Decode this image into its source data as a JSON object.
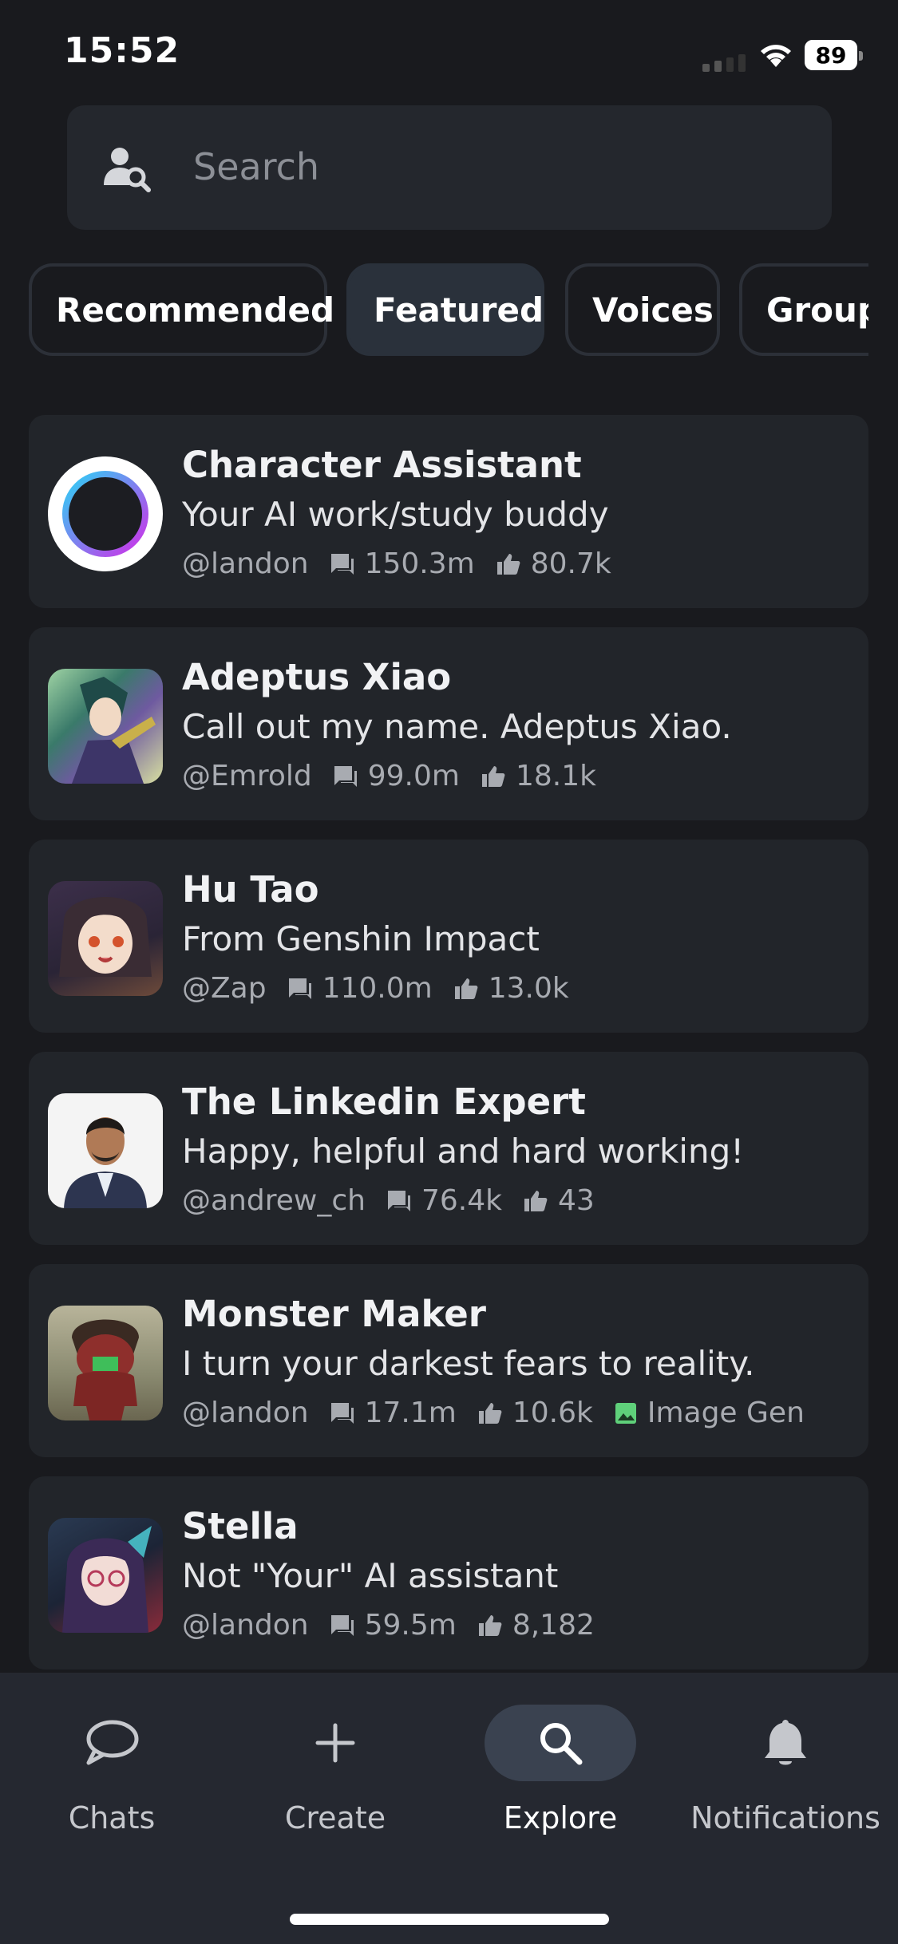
{
  "status_bar": {
    "time": "15:52",
    "battery": "89"
  },
  "search": {
    "placeholder": "Search"
  },
  "tabs": [
    {
      "label": "Recommended",
      "active": false
    },
    {
      "label": "Featured",
      "active": true
    },
    {
      "label": "Voices",
      "active": false
    },
    {
      "label": "Groups",
      "active": false
    }
  ],
  "characters": [
    {
      "name": "Character Assistant",
      "description": "Your AI work/study buddy",
      "author": "@landon",
      "chats": "150.3m",
      "likes": "80.7k",
      "avatar_icon": "ring-logo"
    },
    {
      "name": "Adeptus Xiao",
      "description": "Call out my name. Adeptus Xiao.",
      "author": "@Emrold",
      "chats": "99.0m",
      "likes": "18.1k",
      "avatar_icon": "anime-portrait"
    },
    {
      "name": "Hu Tao",
      "description": "From Genshin Impact",
      "author": "@Zap",
      "chats": "110.0m",
      "likes": "13.0k",
      "avatar_icon": "anime-portrait"
    },
    {
      "name": "The Linkedin Expert",
      "description": "Happy, helpful and hard working!",
      "author": "@andrew_ch",
      "chats": "76.4k",
      "likes": "43",
      "avatar_icon": "person-photo"
    },
    {
      "name": "Monster Maker",
      "description": "I turn your darkest fears to reality.",
      "author": "@landon",
      "chats": "17.1m",
      "likes": "10.6k",
      "tag": "Image Gen",
      "avatar_icon": "monster-art"
    },
    {
      "name": "Stella",
      "description": "Not \"Your\" AI assistant",
      "author": "@landon",
      "chats": "59.5m",
      "likes": "8,182",
      "avatar_icon": "anime-portrait"
    }
  ],
  "bottom_nav": [
    {
      "label": "Chats",
      "icon": "chat-bubble-icon",
      "active": false
    },
    {
      "label": "Create",
      "icon": "plus-icon",
      "active": false
    },
    {
      "label": "Explore",
      "icon": "search-icon",
      "active": true
    },
    {
      "label": "Notifications",
      "icon": "bell-icon",
      "active": false
    }
  ],
  "colors": {
    "background": "#191a1e",
    "card": "#22252a",
    "accent_ring": "#c837e8",
    "image_gen_icon": "#5fd07a"
  }
}
